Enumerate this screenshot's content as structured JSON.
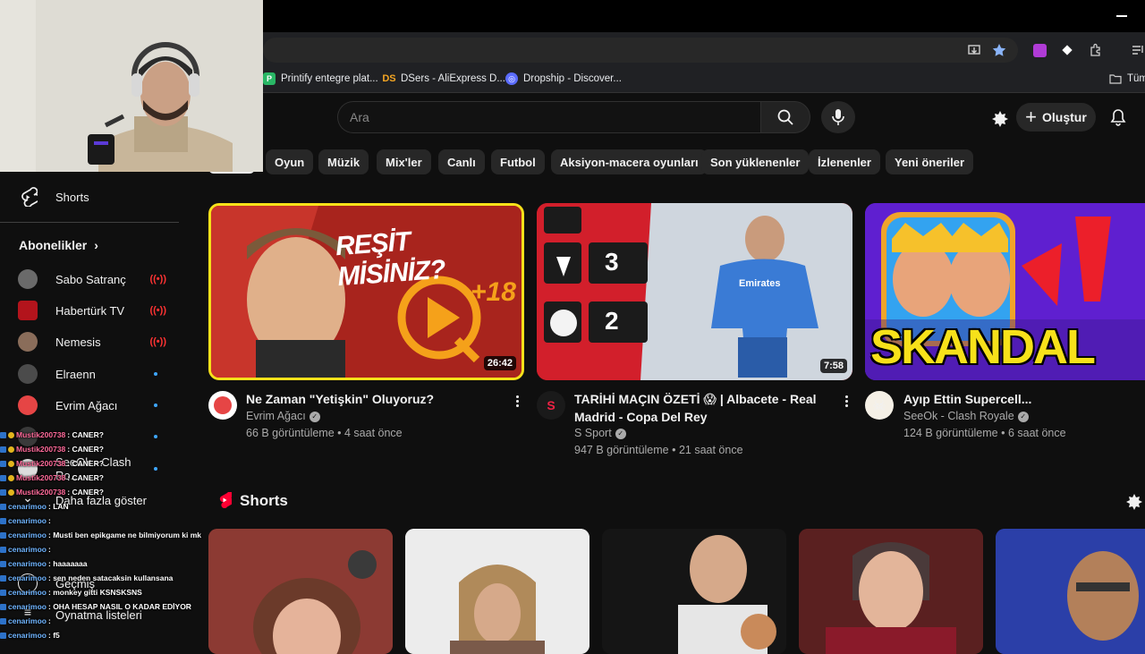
{
  "browser": {
    "bookmarks": [
      {
        "label": "Printify entegre plat...",
        "icon_color": "#29b765"
      },
      {
        "label": "DSers - AliExpress D...",
        "icon_text": "DS",
        "icon_color": "#f5a623"
      },
      {
        "label": "Dropship - Discover...",
        "icon_color": "#5b6cff"
      },
      {
        "label": "Tüm"
      }
    ]
  },
  "header": {
    "search_placeholder": "Ara",
    "create_label": "Oluştur"
  },
  "chips": [
    "Oyun",
    "Müzik",
    "Mix'ler",
    "Canlı",
    "Futbol",
    "Aksiyon-macera oyunları",
    "Son yüklenenler",
    "İzlenenler",
    "Yeni öneriler"
  ],
  "sidebar": {
    "shorts_label": "Shorts",
    "subscriptions_title": "Abonelikler",
    "subscriptions": [
      {
        "name": "Sabo Satranç",
        "status": "live"
      },
      {
        "name": "Habertürk TV",
        "status": "live"
      },
      {
        "name": "Nemesis",
        "status": "live"
      },
      {
        "name": "Elraenn",
        "status": "new"
      },
      {
        "name": "Evrim Ağacı",
        "status": "new"
      },
      {
        "name": "",
        "status": "new"
      },
      {
        "name": "SeeOk - Clash Ro...",
        "status": "new"
      }
    ],
    "show_more": "Daha fazla göster",
    "history": "Geçmiş",
    "playlists": "Oynatma listeleri"
  },
  "chat": [
    {
      "user": "Mustik200738",
      "msg": ": CANER?"
    },
    {
      "user": "Mustik200738",
      "msg": ": CANER?"
    },
    {
      "user": "Mustik200738",
      "msg": ": CANER?"
    },
    {
      "user": "Mustik200738",
      "msg": ": CANER?"
    },
    {
      "user": "Mustik200738",
      "msg": ": CANER?"
    },
    {
      "user": "cenarimoo",
      "msg": ": LAN"
    },
    {
      "user": "cenarimoo",
      "msg": ":"
    },
    {
      "user": "cenarimoo",
      "msg": ": Musti ben epikgame ne bilmiyorum ki mk"
    },
    {
      "user": "cenarimoo",
      "msg": ":"
    },
    {
      "user": "cenarimoo",
      "msg": ": haaaaaaa"
    },
    {
      "user": "cenarimoo",
      "msg": ": sen neden satacaksin kullansana"
    },
    {
      "user": "cenarimoo",
      "msg": ": monkey gitti KSNSKSNS"
    },
    {
      "user": "cenarimoo",
      "msg": ": OHA HESAP NASIL O KADAR EDİYOR"
    },
    {
      "user": "cenarimoo",
      "msg": ":"
    },
    {
      "user": "cenarimoo",
      "msg": ": f5"
    }
  ],
  "videos": [
    {
      "thumb_text": "REŞİT MİSİNİZ?",
      "thumb_badge": "+18",
      "duration": "26:42",
      "title_line1": "Ne Zaman \"Yetişkin\" Oluyoruz?",
      "title_line2": "",
      "channel": "Evrim Ağacı",
      "meta": "66 B görüntüleme • 4 saat önce"
    },
    {
      "thumb_score_top": "3",
      "thumb_score_bottom": "2",
      "thumb_shirt": "Emirates",
      "duration": "7:58",
      "title_line1": "TARİHİ MAÇIN ÖZETİ 😱 | Albacete - Real",
      "title_line2": "Madrid - Copa Del Rey",
      "channel": "S Sport",
      "meta": "947 B görüntüleme • 21 saat önce"
    },
    {
      "thumb_text": "SKANDAL",
      "duration": "",
      "title_line1": "Ayıp Ettin Supercell...",
      "title_line2": "",
      "channel": "SeeOk - Clash Royale",
      "meta": "124 B görüntüleme • 6 saat önce"
    }
  ],
  "shorts_section": {
    "title": "Shorts"
  }
}
